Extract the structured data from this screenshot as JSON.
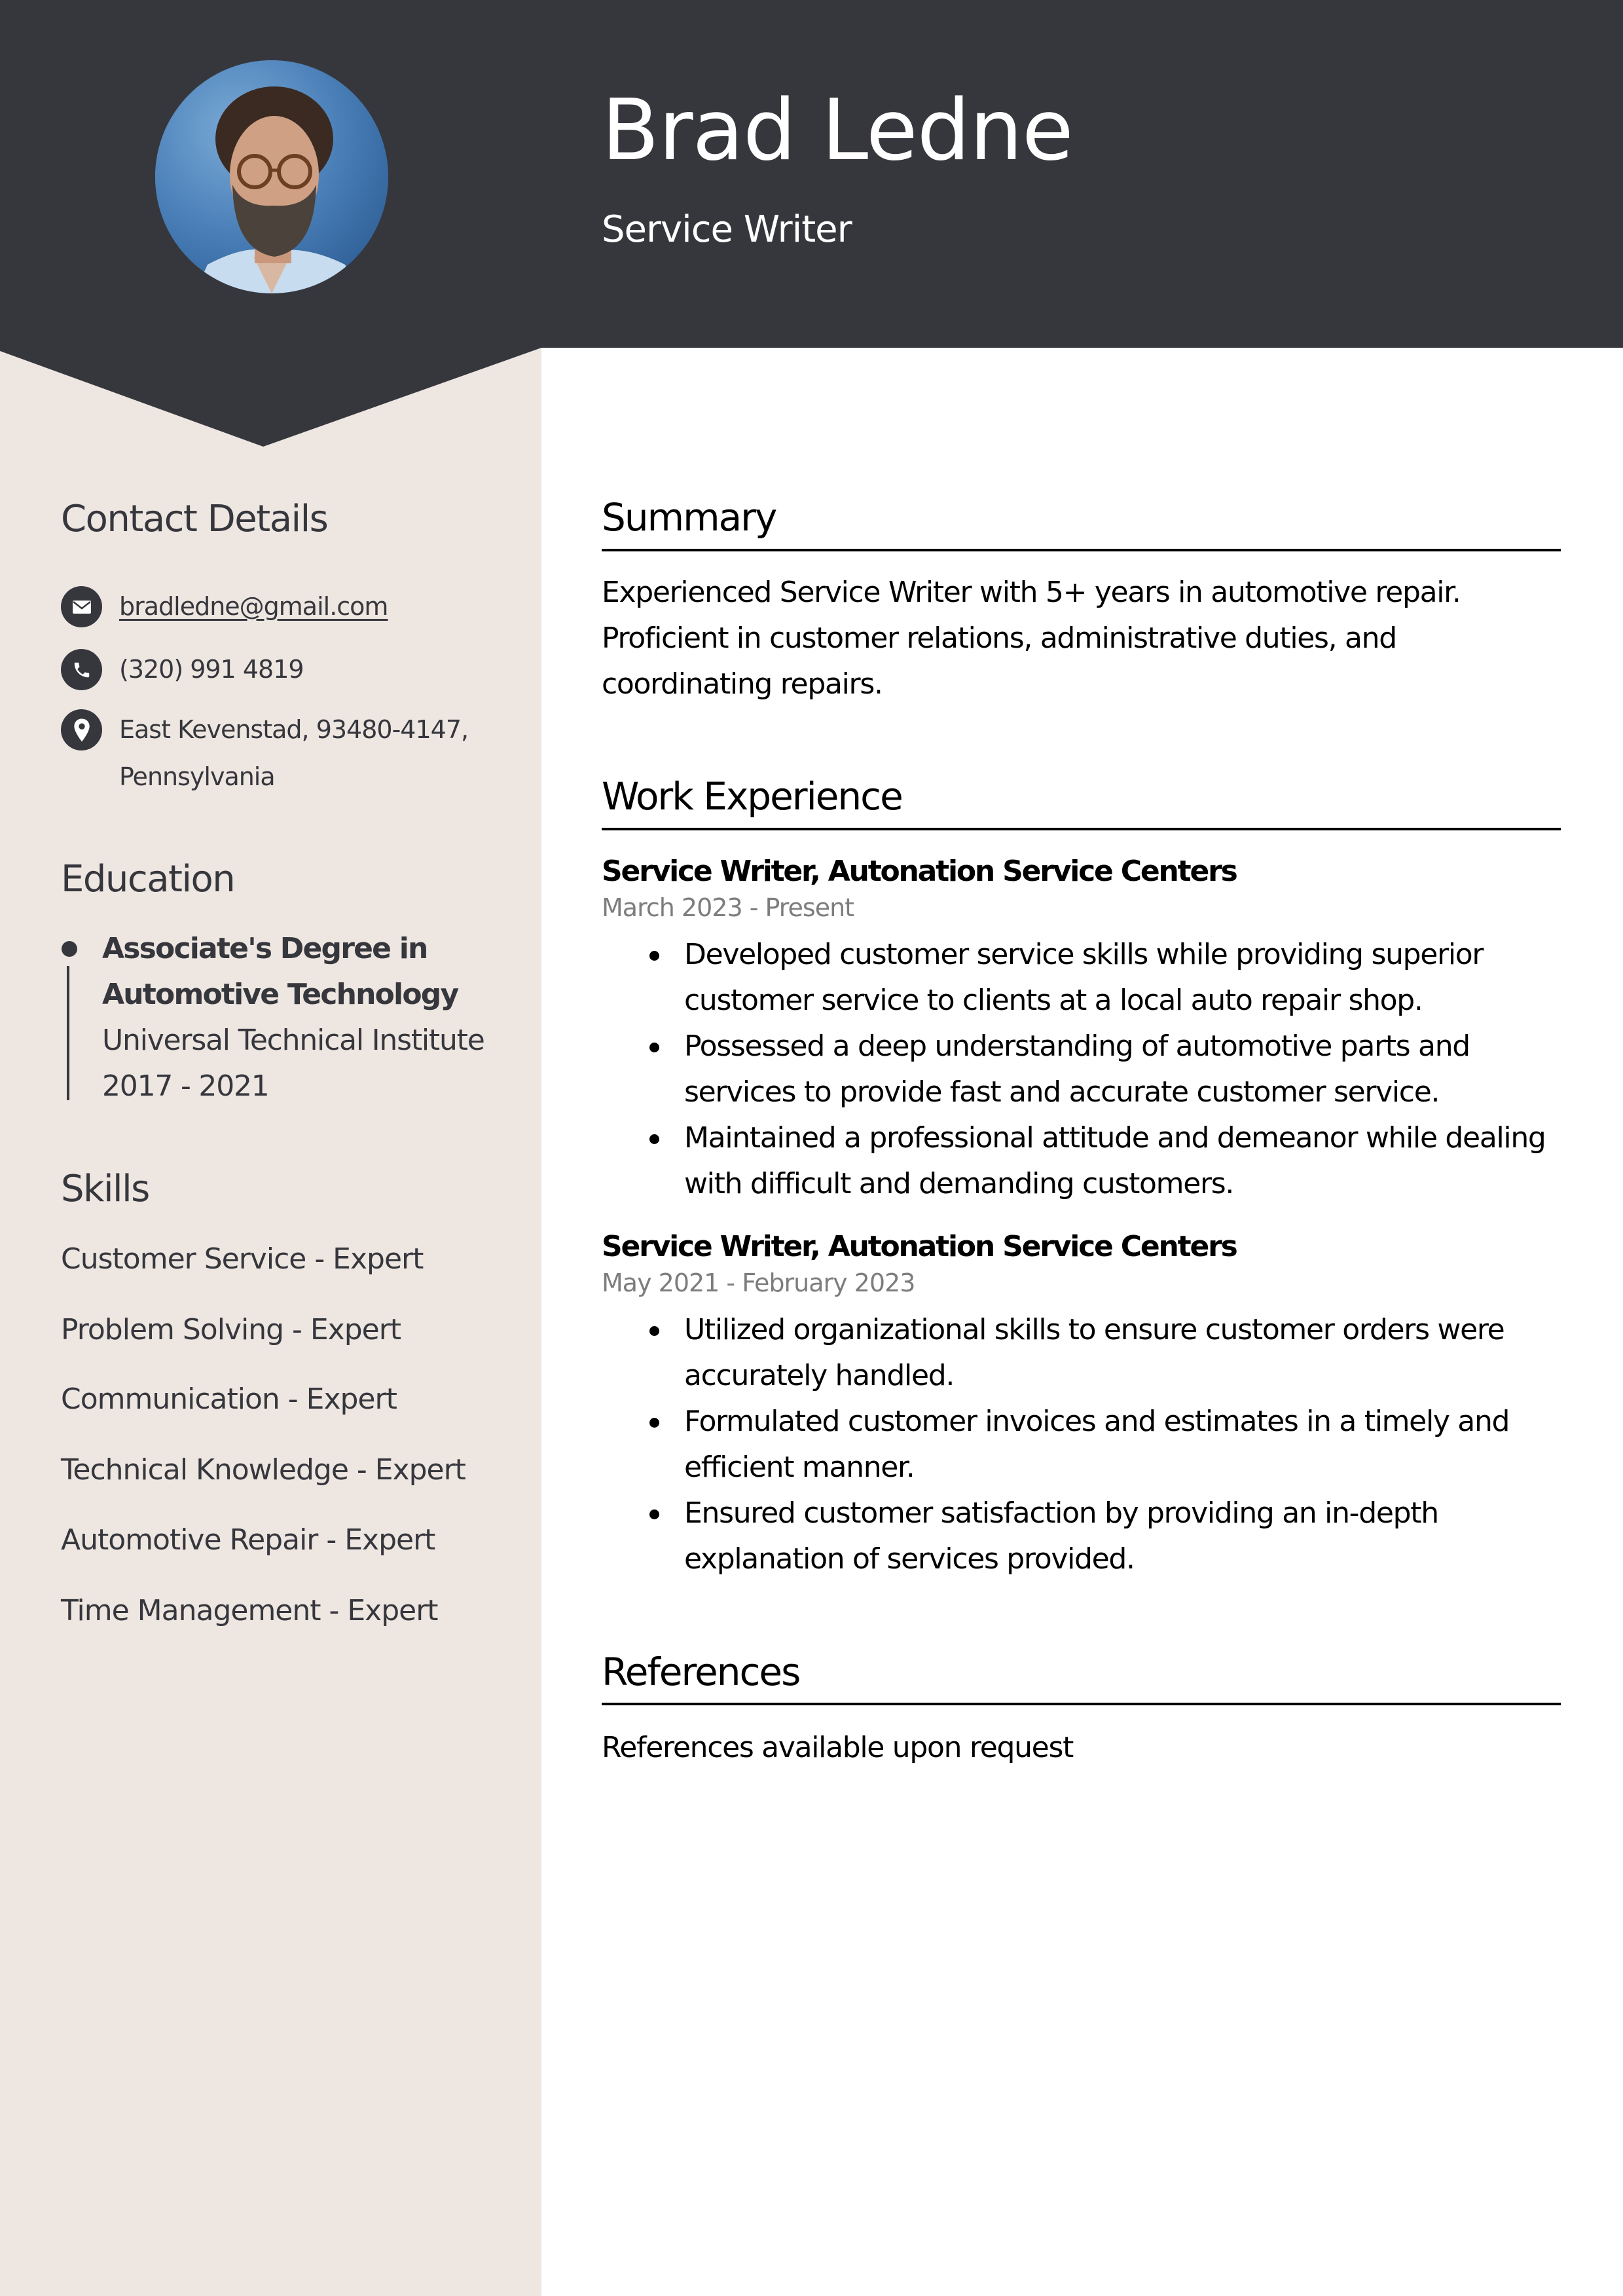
{
  "colors": {
    "header_dark": "#36373d",
    "sidebar_bg": "#eee6e1",
    "text_dark": "#36373d",
    "date_gray": "#7d7d7d",
    "photo_bg_blue": "#4a7fb8"
  },
  "header": {
    "name": "Brad Ledne",
    "title": "Service Writer",
    "photo": "profile-photo"
  },
  "sidebar": {
    "contact": {
      "heading": "Contact Details",
      "email": {
        "icon": "envelope-icon",
        "value": "bradledne@gmail.com"
      },
      "phone": {
        "icon": "phone-icon",
        "value": "(320) 991 4819"
      },
      "address": {
        "icon": "map-pin-icon",
        "line1": "East Kevenstad, 93480-4147,",
        "line2": "Pennsylvania"
      }
    },
    "education": {
      "heading": "Education",
      "items": [
        {
          "degree_line1": "Associate's Degree in",
          "degree_line2": "Automotive Technology",
          "institution": "Universal Technical Institute",
          "years": "2017 - 2021"
        }
      ]
    },
    "skills": {
      "heading": "Skills",
      "items": [
        "Customer Service - Expert",
        "Problem Solving - Expert",
        "Communication - Expert",
        "Technical Knowledge - Expert",
        "Automotive Repair - Expert",
        "Time Management - Expert"
      ]
    }
  },
  "main": {
    "summary": {
      "heading": "Summary",
      "text": "Experienced Service Writer with 5+ years in automotive repair. Proficient in customer relations, administrative duties, and coordinating repairs."
    },
    "experience": {
      "heading": "Work Experience",
      "jobs": [
        {
          "title": "Service Writer, Autonation Service Centers",
          "dates": "March 2023 - Present",
          "bullets": [
            "Developed customer service skills while providing superior customer service to clients at a local auto repair shop.",
            "Possessed a deep understanding of automotive parts and services to provide fast and accurate customer service.",
            "Maintained a professional attitude and demeanor while dealing with difficult and demanding customers."
          ]
        },
        {
          "title": "Service Writer, Autonation Service Centers",
          "dates": "May 2021 - February 2023",
          "bullets": [
            "Utilized organizational skills to ensure customer orders were accurately handled.",
            "Formulated customer invoices and estimates in a timely and efficient manner.",
            "Ensured customer satisfaction by providing an in-depth explanation of services provided."
          ]
        }
      ]
    },
    "references": {
      "heading": "References",
      "text": "References available upon request"
    }
  }
}
